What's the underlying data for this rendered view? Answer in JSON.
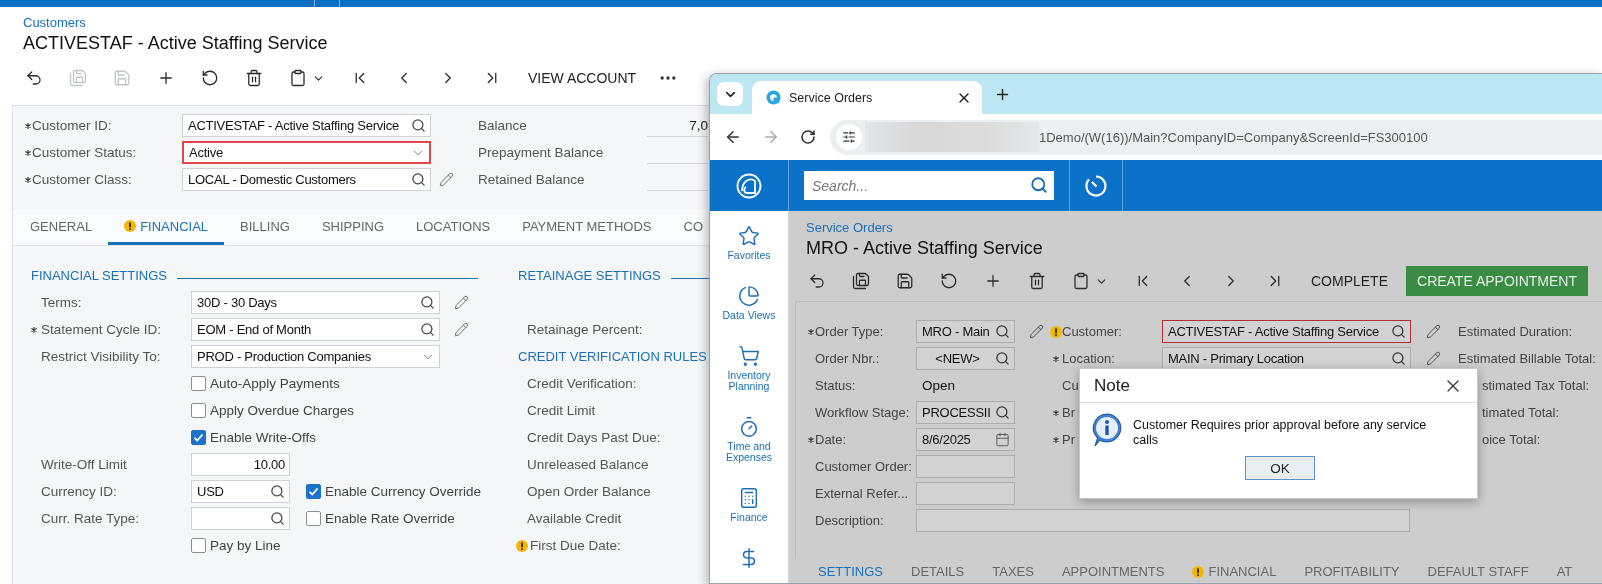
{
  "customers": {
    "breadcrumb": "Customers",
    "title": "ACTIVESTAF - Active Staffing Service",
    "toolbar": {
      "icon_buttons": [
        {
          "disabled": false
        },
        {
          "disabled": true
        },
        {
          "disabled": true
        },
        {
          "disabled": false
        },
        {
          "disabled": false
        },
        {
          "disabled": false
        },
        {
          "disabled": false
        },
        {
          "disabled": false
        },
        {
          "disabled": false
        },
        {
          "disabled": false
        },
        {
          "disabled": false
        }
      ],
      "actions": [
        "VIEW ACCOUNT"
      ]
    },
    "header_fields": [
      {
        "label": "Customer ID:",
        "required": true,
        "kind": "lookup",
        "value": "ACTIVESTAF - Active Staffing Service"
      },
      {
        "label": "Customer Status:",
        "required": true,
        "kind": "select",
        "value": "Active",
        "highlighted": true
      },
      {
        "label": "Customer Class:",
        "required": true,
        "kind": "lookup",
        "value": "LOCAL - Domestic Customers",
        "pencil": true
      }
    ],
    "summary": [
      {
        "label": "Balance",
        "value": "7,0"
      },
      {
        "label": "Prepayment Balance"
      },
      {
        "label": "Retained Balance"
      }
    ],
    "tabs": [
      {
        "label": "GENERAL",
        "selected": false
      },
      {
        "label": "FINANCIAL",
        "selected": true,
        "warning": true
      },
      {
        "label": "BILLING",
        "selected": false
      },
      {
        "label": "SHIPPING",
        "selected": false
      },
      {
        "label": "LOCATIONS",
        "selected": false
      },
      {
        "label": "PAYMENT METHODS",
        "selected": false
      },
      {
        "label": "CO",
        "selected": false
      }
    ],
    "financial": {
      "sections": [
        "FINANCIAL SETTINGS",
        "RETAINAGE SETTINGS"
      ],
      "rows": [
        {
          "kind": "lookup",
          "label": "Terms:",
          "value": "30D - 30 Days",
          "pencil": true
        },
        {
          "kind": "lookup",
          "label": "Statement Cycle ID:",
          "required": true,
          "value": "EOM - End of Month",
          "pencil": true
        },
        {
          "kind": "select",
          "label": "Restrict Visibility To:",
          "value": "PROD - Production Companies"
        },
        {
          "kind": "check",
          "label": "Auto-Apply Payments",
          "checked": false
        },
        {
          "kind": "check",
          "label": "Apply Overdue Charges",
          "checked": false
        },
        {
          "kind": "check",
          "label": "Enable Write-Offs",
          "checked": true
        },
        {
          "kind": "number",
          "label": "Write-Off Limit",
          "value": "10.00"
        },
        {
          "kind": "lookup",
          "label": "Currency ID:",
          "value": "USD",
          "side_check": {
            "label": "Enable Currency Override",
            "checked": true
          }
        },
        {
          "kind": "lookup",
          "label": "Curr. Rate Type:",
          "side_check": {
            "label": "Enable Rate Override",
            "checked": false
          }
        },
        {
          "kind": "check",
          "label": "Pay by Line",
          "checked": false
        }
      ],
      "right": [
        {
          "kind": "label",
          "text": "Retainage Percent:"
        },
        {
          "kind": "header",
          "text": "CREDIT VERIFICATION RULES"
        },
        {
          "kind": "label",
          "text": "Credit Verification:"
        },
        {
          "kind": "label",
          "text": "Credit Limit"
        },
        {
          "kind": "label",
          "text": "Credit Days Past Due:"
        },
        {
          "kind": "label",
          "text": "Unreleased Balance"
        },
        {
          "kind": "label",
          "text": "Open Order Balance"
        },
        {
          "kind": "label",
          "text": "Available Credit"
        },
        {
          "kind": "label",
          "text": "First Due Date:",
          "warning": true
        }
      ]
    }
  },
  "browser": {
    "tab_title": "Service Orders",
    "url": "1Demo/(W(16))/Main?CompanyID=Company&ScreenId=FS300100",
    "app": {
      "search_placeholder": "Search...",
      "nav": [
        "Favorites",
        "Data Views",
        "Inventory Planning",
        "Time and Expenses",
        "Finance"
      ],
      "breadcrumb": "Service Orders",
      "title": "MRO - Active Staffing Service",
      "actions": [
        {
          "label": "COMPLETE",
          "kind": "text"
        },
        {
          "label": "CREATE APPOINTMENT",
          "kind": "primary"
        }
      ],
      "form": {
        "col1": [
          {
            "label": "Order Type:",
            "required": true,
            "kind": "lookup",
            "value": "MRO - Main",
            "pencil": true
          },
          {
            "label": "Order Nbr.:",
            "kind": "lookup",
            "value": "<NEW>"
          },
          {
            "label": "Status:",
            "kind": "text",
            "value": "Open"
          },
          {
            "label": "Workflow Stage:",
            "kind": "lookup",
            "value": "PROCESSII"
          },
          {
            "label": "Date:",
            "required": true,
            "kind": "date",
            "value": "8/6/2025"
          },
          {
            "label": "Customer Order:",
            "kind": "input"
          },
          {
            "label": "External Refer...",
            "kind": "input"
          }
        ],
        "col2": [
          {
            "label": "Customer:",
            "warning": true,
            "kind": "lookup",
            "value": "ACTIVESTAF - Active Staffing Service",
            "highlighted": true,
            "pencil": true
          },
          {
            "label": "Location:",
            "required": true,
            "kind": "lookup",
            "value": "MAIN - Primary Location",
            "pencil": true
          },
          {
            "label": "Cu",
            "kind": "label"
          },
          {
            "label": "Br",
            "required": true,
            "kind": "label"
          },
          {
            "label": "Pr",
            "required": true,
            "kind": "label"
          }
        ],
        "col3": [
          "Estimated Duration:",
          "Estimated Billable Total:",
          "stimated Tax Total:",
          "timated Total:",
          "oice Total:"
        ],
        "description": {
          "label": "Description:"
        }
      },
      "tabs": [
        {
          "label": "SETTINGS",
          "selected": true
        },
        {
          "label": "DETAILS",
          "selected": false
        },
        {
          "label": "TAXES",
          "selected": false
        },
        {
          "label": "APPOINTMENTS",
          "selected": false
        },
        {
          "label": "FINANCIAL",
          "selected": false,
          "warning": true
        },
        {
          "label": "PROFITABILITY",
          "selected": false
        },
        {
          "label": "DEFAULT STAFF",
          "selected": false
        },
        {
          "label": "AT",
          "selected": false
        }
      ],
      "dialog": {
        "title": "Note",
        "message": "Customer Requires prior approval before any service calls",
        "button": "OK"
      }
    }
  }
}
